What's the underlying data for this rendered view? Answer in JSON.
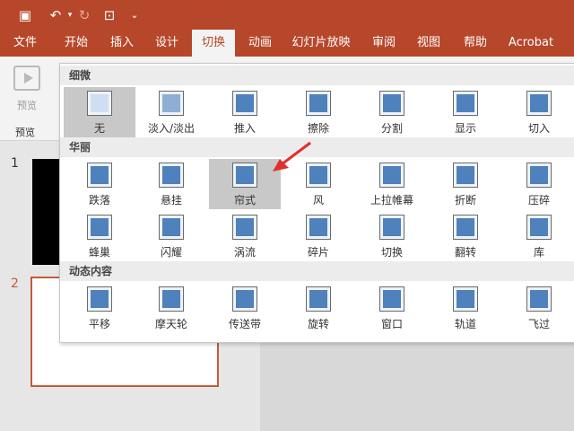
{
  "qat": {
    "save_icon": "floppy-icon",
    "undo_icon": "undo-icon",
    "redo_icon": "redo-icon",
    "present_icon": "present-from-start-icon",
    "customize_icon": "chevron-down-icon"
  },
  "menu": [
    "文件",
    "开始",
    "插入",
    "设计",
    "切换",
    "动画",
    "幻灯片放映",
    "审阅",
    "视图",
    "帮助",
    "Acrobat"
  ],
  "active_menu": "切换",
  "ribbon": {
    "preview_label": "预览",
    "group_label": "预览"
  },
  "thumbnails": {
    "slide1_num": "1",
    "slide2_num": "2"
  },
  "gallery": {
    "sections": [
      {
        "title": "细微",
        "items": [
          "无",
          "淡入/淡出",
          "推入",
          "擦除",
          "分割",
          "显示",
          "切入"
        ]
      },
      {
        "title": "华丽",
        "items": [
          "跌落",
          "悬挂",
          "帘式",
          "风",
          "上拉帷幕",
          "折断",
          "压碎",
          "蜂巢",
          "闪耀",
          "涡流",
          "碎片",
          "切换",
          "翻转",
          "库"
        ]
      },
      {
        "title": "动态内容",
        "items": [
          "平移",
          "摩天轮",
          "传送带",
          "旋转",
          "窗口",
          "轨道",
          "飞过"
        ]
      }
    ],
    "selected_item": "帘式"
  },
  "colors": {
    "accent": "#b7472a",
    "icon_blue": "#4f81bd",
    "arrow": "#e0302a"
  }
}
